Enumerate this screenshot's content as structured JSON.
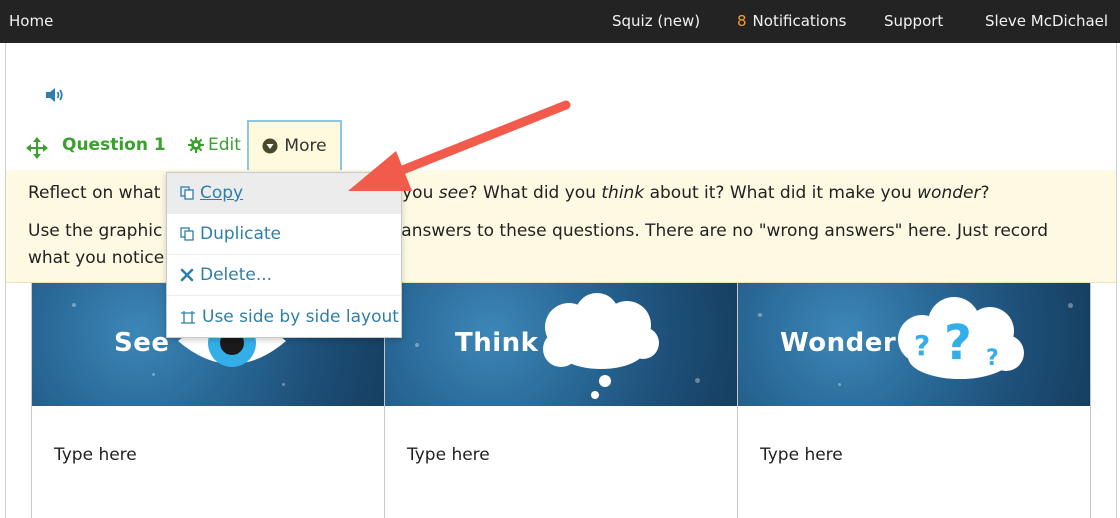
{
  "topbar": {
    "home": "Home",
    "site": "Squiz (new)",
    "notifications_count": "8",
    "notifications_label": "Notifications",
    "support": "Support",
    "user": "Sleve McDichael"
  },
  "toolbar": {
    "question_title": "Question 1",
    "edit_label": "Edit",
    "more_label": "More"
  },
  "instructions": {
    "line1_a": "Reflect on what y",
    "line1_b": "d you ",
    "line1_see": "see",
    "line1_c": "? What did you ",
    "line1_think": "think",
    "line1_d": " about it? What did it make you ",
    "line1_wonder": "wonder",
    "line1_e": "?",
    "line2_a": "Use the graphic o",
    "line2_b": "ur answers to these questions. There are no \"wrong answers\" here. Just record",
    "line3": "what you notice"
  },
  "menu": {
    "items": [
      {
        "label": "Copy"
      },
      {
        "label": "Duplicate"
      },
      {
        "label": "Delete..."
      },
      {
        "label": "Use side by side layout"
      }
    ]
  },
  "columns": [
    {
      "heading": "See",
      "placeholder": "Type here"
    },
    {
      "heading": "Think",
      "placeholder": "Type here"
    },
    {
      "heading": "Wonder",
      "placeholder": "Type here"
    }
  ],
  "colors": {
    "accent_green": "#3aa02e",
    "link_blue": "#2c7fab",
    "annotation_red": "#f25b4b",
    "notice_bg": "#fdf9e2"
  },
  "icons": {
    "speaker": "speaker-icon",
    "move": "move-icon",
    "edit": "gear-icon",
    "more": "chevron-down-circle-icon",
    "copy": "copy-icon",
    "duplicate": "duplicate-icon",
    "delete": "close-icon",
    "layout": "side-by-side-icon"
  }
}
